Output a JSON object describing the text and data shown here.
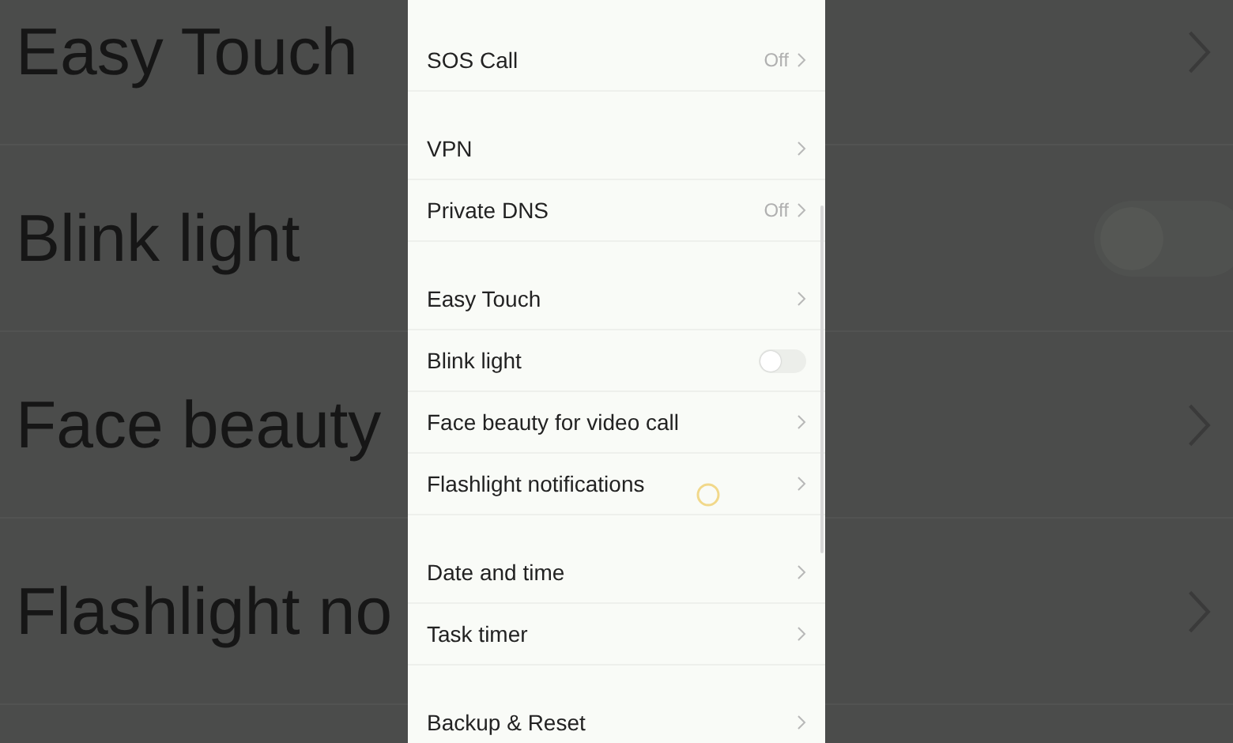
{
  "backdrop": {
    "rows": [
      {
        "label": "Easy Touch",
        "kind": "link"
      },
      {
        "label": "Blink light",
        "kind": "toggle",
        "on": false
      },
      {
        "label": "Face beauty",
        "kind": "link"
      },
      {
        "label": "Flashlight no",
        "kind": "link"
      }
    ]
  },
  "settings": {
    "groups": [
      {
        "items": [
          {
            "label": "SOS Call",
            "kind": "link",
            "value": "Off"
          }
        ]
      },
      {
        "items": [
          {
            "label": "VPN",
            "kind": "link"
          },
          {
            "label": "Private DNS",
            "kind": "link",
            "value": "Off"
          }
        ]
      },
      {
        "items": [
          {
            "label": "Easy Touch",
            "kind": "link"
          },
          {
            "label": "Blink light",
            "kind": "toggle",
            "on": false
          },
          {
            "label": "Face beauty for video call",
            "kind": "link"
          },
          {
            "label": "Flashlight notifications",
            "kind": "link"
          }
        ]
      },
      {
        "items": [
          {
            "label": "Date and time",
            "kind": "link"
          },
          {
            "label": "Task timer",
            "kind": "link"
          }
        ]
      },
      {
        "items": [
          {
            "label": "Backup & Reset",
            "kind": "link"
          }
        ]
      }
    ]
  }
}
